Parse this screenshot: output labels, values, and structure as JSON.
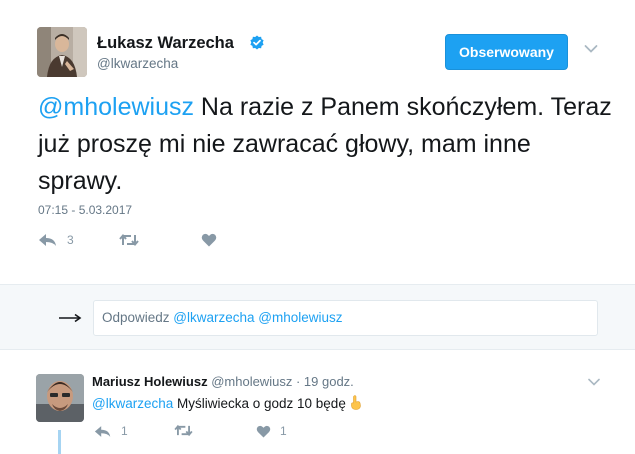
{
  "tweet": {
    "author_name": "Łukasz Warzecha",
    "author_handle": "@lkwarzecha",
    "follow_label": "Obserwowany",
    "mention": "@mholewiusz",
    "text": " Na razie z Panem skończyłem. Teraz już proszę mi nie zawracać głowy, mam inne sprawy.",
    "timestamp": "07:15 - 5.03.2017",
    "reply_count": "3",
    "retweet_count": "",
    "like_count": ""
  },
  "reply_box": {
    "prefix": "Odpowiedz ",
    "mentions": "@lkwarzecha @mholewiusz"
  },
  "reply": {
    "author_name": "Mariusz Holewiusz",
    "author_handle": "@mholewiusz",
    "separator": "·",
    "time": "19 godz.",
    "mention": "@lkwarzecha",
    "text": " Myśliwiecka o godz 10 będę",
    "reply_count": "1",
    "like_count": "1"
  },
  "icons": {
    "verified": "verified-badge-icon",
    "caret": "chevron-down-icon",
    "reply": "reply-icon",
    "retweet": "retweet-icon",
    "like": "heart-icon",
    "arrow": "right-arrow-icon",
    "emoji": "pointing-hand-emoji-icon"
  },
  "colors": {
    "accent": "#1da1f2",
    "text": "#14171a",
    "muted": "#657786",
    "action": "#8899a6"
  }
}
